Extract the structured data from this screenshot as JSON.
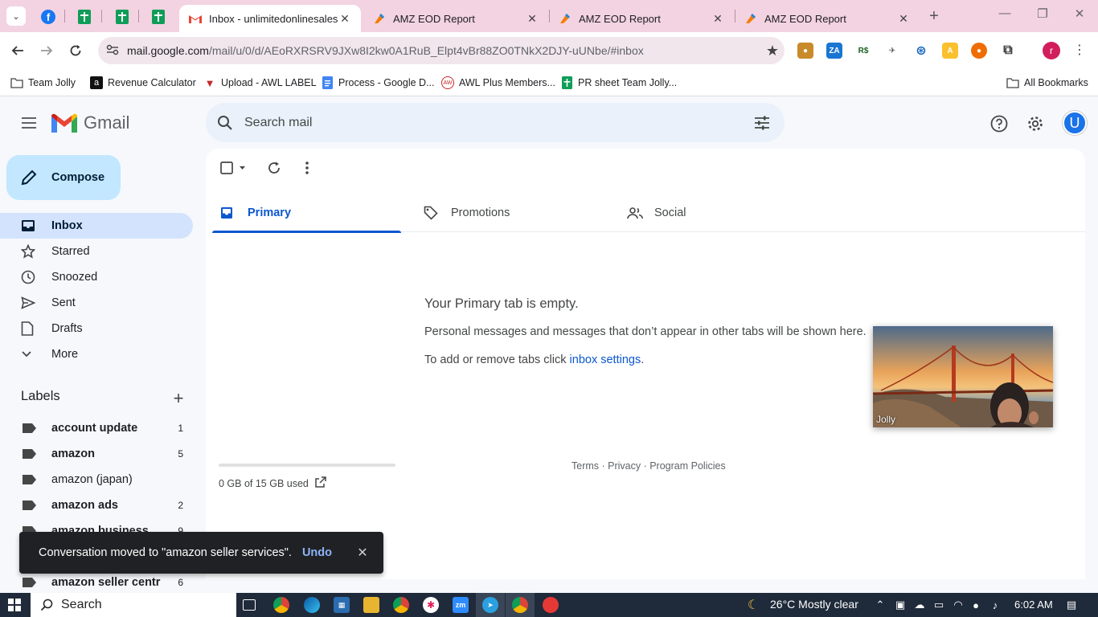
{
  "browser": {
    "tabs": [
      {
        "title": "Inbox - unlimitedonlinesalesllc",
        "active": true
      },
      {
        "title": "AMZ EOD Report",
        "active": false
      },
      {
        "title": "AMZ EOD Report",
        "active": false
      },
      {
        "title": "AMZ EOD Report",
        "active": false
      }
    ],
    "url_host": "mail.google.com",
    "url_path": "/mail/u/0/d/AEoRXRSRV9JXw8I2kw0A1RuB_Elpt4vBr88ZO0TNkX2DJY-uUNbe/#inbox",
    "profile_initial": "r",
    "bookmarks": [
      {
        "label": "Team Jolly"
      },
      {
        "label": "Revenue Calculator"
      },
      {
        "label": "Upload - AWL LABEL"
      },
      {
        "label": "Process - Google D..."
      },
      {
        "label": "AWL Plus Members..."
      },
      {
        "label": "PR sheet Team Jolly..."
      }
    ],
    "all_bookmarks": "All Bookmarks"
  },
  "gmail": {
    "wordmark": "Gmail",
    "search_placeholder": "Search mail",
    "avatar_initial": "U",
    "compose": "Compose",
    "nav": [
      {
        "label": "Inbox",
        "icon": "inbox-icon",
        "active": true
      },
      {
        "label": "Starred",
        "icon": "star-icon"
      },
      {
        "label": "Snoozed",
        "icon": "clock-icon"
      },
      {
        "label": "Sent",
        "icon": "send-icon"
      },
      {
        "label": "Drafts",
        "icon": "draft-icon"
      },
      {
        "label": "More",
        "icon": "chevron-down-icon"
      }
    ],
    "labels_title": "Labels",
    "labels": [
      {
        "name": "account update",
        "count": "1",
        "bold": true
      },
      {
        "name": "amazon",
        "count": "5",
        "bold": true
      },
      {
        "name": "amazon (japan)",
        "count": "",
        "bold": false
      },
      {
        "name": "amazon ads",
        "count": "2",
        "bold": true
      },
      {
        "name": "amazon business",
        "count": "9",
        "bold": true
      },
      {
        "name": "amazon seller centr",
        "count": "6",
        "bold": true
      }
    ],
    "category_tabs": [
      {
        "label": "Primary",
        "active": true
      },
      {
        "label": "Promotions",
        "active": false
      },
      {
        "label": "Social",
        "active": false
      }
    ],
    "empty": {
      "title": "Your Primary tab is empty.",
      "line1": "Personal messages and messages that don’t appear in other tabs will be shown here.",
      "line2_prefix": "To add or remove tabs click ",
      "line2_link": "inbox settings",
      "line2_suffix": "."
    },
    "storage": {
      "text": "0 GB of 15 GB used",
      "fraction": 0.0
    },
    "footer": "Terms · Privacy · Program Policies",
    "video_name": "Jolly",
    "snackbar": {
      "message": "Conversation moved to \"amazon seller services\".",
      "action": "Undo"
    }
  },
  "taskbar": {
    "search": "Search",
    "weather": "26°C  Mostly clear",
    "time": "6:02 AM"
  },
  "colors": {
    "tabstrip": "#f3d3e1",
    "compose_bg": "#c2e7ff",
    "active_nav": "#d3e3fd",
    "accent": "#0b57d0"
  }
}
